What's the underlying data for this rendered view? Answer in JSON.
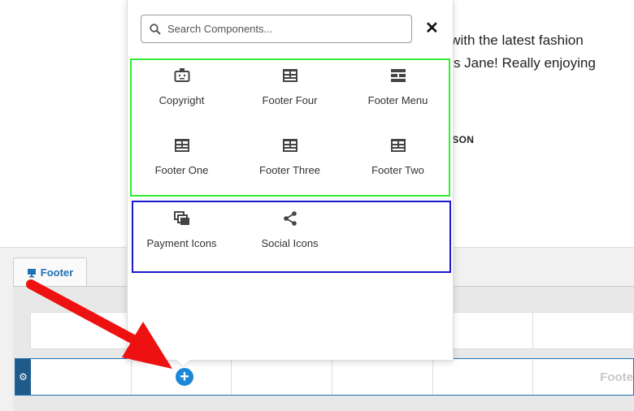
{
  "background": {
    "testimonial_line1": "e with the latest fashion",
    "testimonial_line2": "nks Jane! Really enjoying",
    "author": "PSON"
  },
  "builder": {
    "tab_label": "Footer",
    "row_label": "Foote"
  },
  "popup": {
    "search_placeholder": "Search Components...",
    "close_label": "✕",
    "components": [
      {
        "label": "Copyright",
        "icon": "copyright-icon"
      },
      {
        "label": "Footer Four",
        "icon": "footer-layout-icon"
      },
      {
        "label": "Footer Menu",
        "icon": "footer-menu-icon"
      },
      {
        "label": "Footer One",
        "icon": "footer-layout-icon"
      },
      {
        "label": "Footer Three",
        "icon": "footer-layout-icon"
      },
      {
        "label": "Footer Two",
        "icon": "footer-layout-icon"
      },
      {
        "label": "Payment Icons",
        "icon": "payment-icons-icon"
      },
      {
        "label": "Social Icons",
        "icon": "share-icon"
      }
    ]
  },
  "colors": {
    "accent": "#2271b1",
    "green_highlight": "#33ee33",
    "blue_highlight": "#1a1acc",
    "arrow": "#ee1111"
  }
}
